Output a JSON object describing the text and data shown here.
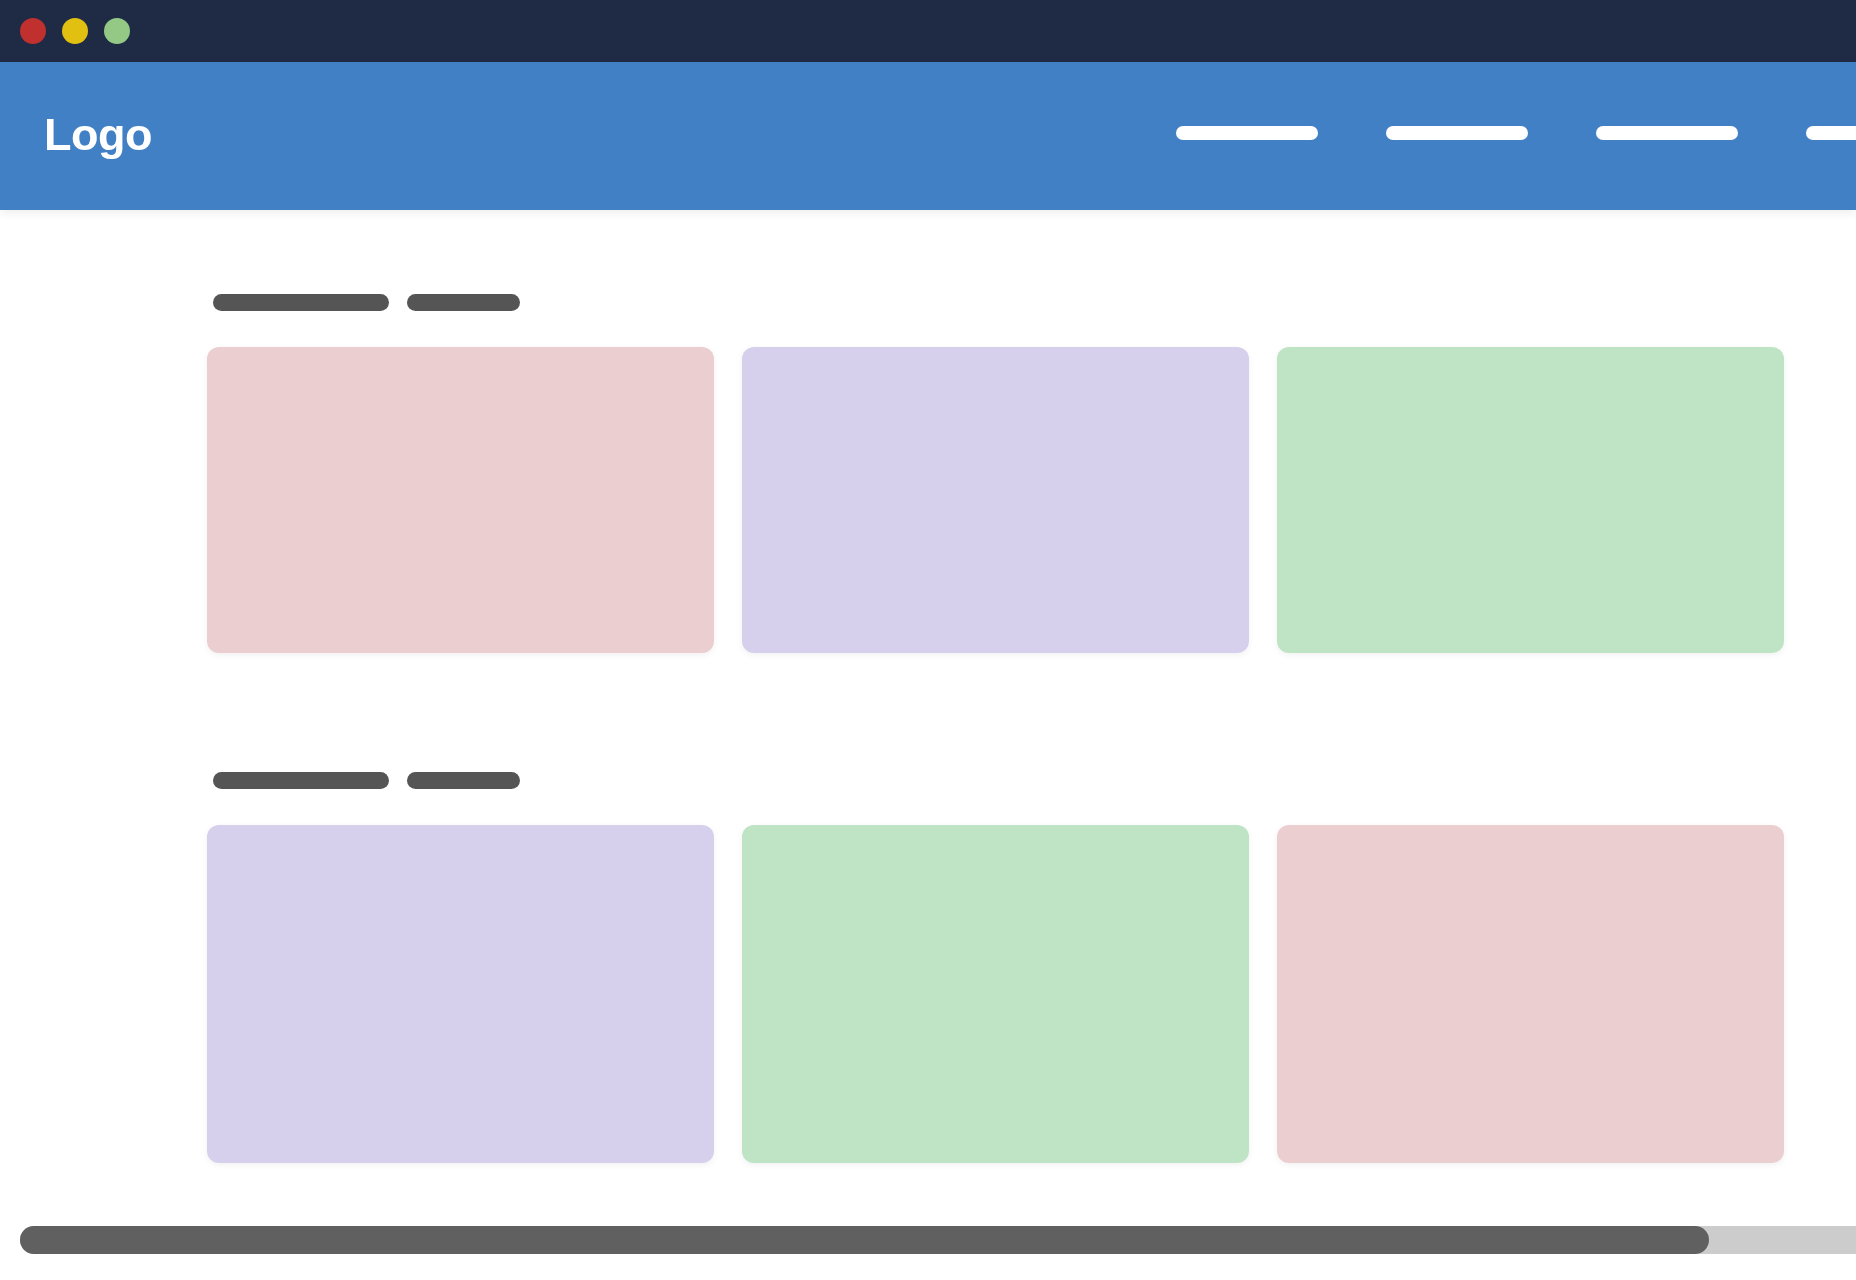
{
  "window": {
    "controls": [
      {
        "color": "#c0302e"
      },
      {
        "color": "#e2c012"
      },
      {
        "color": "#93c885"
      }
    ]
  },
  "header": {
    "logo": "Logo",
    "nav_links": [
      {
        "kind": "line"
      },
      {
        "kind": "line"
      },
      {
        "kind": "line"
      },
      {
        "kind": "line"
      }
    ]
  },
  "sections": [
    {
      "heading": [
        {
          "kind": "long"
        },
        {
          "kind": "short"
        }
      ],
      "cards": [
        {
          "color": "#ebcfd0"
        },
        {
          "color": "#d7d0ec"
        },
        {
          "color": "#bfe3c5"
        }
      ]
    },
    {
      "heading": [
        {
          "kind": "long"
        },
        {
          "kind": "short"
        }
      ],
      "cards": [
        {
          "color": "#d7d0ec"
        },
        {
          "color": "#bfe3c5"
        },
        {
          "color": "#ebcfd0"
        }
      ]
    }
  ]
}
